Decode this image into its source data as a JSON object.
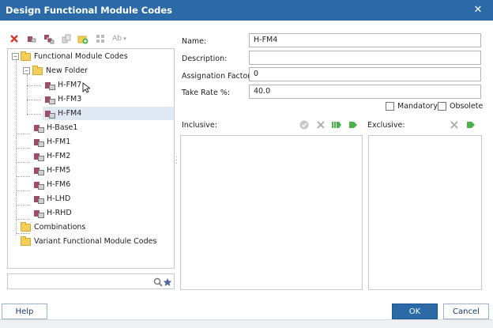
{
  "window": {
    "title": "Design Functional Module Codes",
    "close_icon": "close-icon"
  },
  "toolbar": {
    "icons": [
      "delete-icon",
      "functional-module-icon",
      "functional-module-group-icon",
      "copy-icon",
      "new-folder-icon",
      "grid-icon",
      "rename-icon",
      "dropdown-icon"
    ]
  },
  "tree": {
    "nodes": [
      {
        "label": "Functional Module Codes",
        "icon": "folder-open-icon"
      },
      {
        "label": "New Folder",
        "icon": "folder-open-icon"
      },
      {
        "label": "H-FM7",
        "icon": "functional-module-icon"
      },
      {
        "label": "H-FM3",
        "icon": "functional-module-icon"
      },
      {
        "label": "H-FM4",
        "icon": "functional-module-icon",
        "selected": true
      },
      {
        "label": "H-Base1",
        "icon": "functional-module-icon"
      },
      {
        "label": "H-FM1",
        "icon": "functional-module-icon"
      },
      {
        "label": "H-FM2",
        "icon": "functional-module-icon"
      },
      {
        "label": "H-FM5",
        "icon": "functional-module-icon"
      },
      {
        "label": "H-FM6",
        "icon": "functional-module-icon"
      },
      {
        "label": "H-LHD",
        "icon": "functional-module-icon"
      },
      {
        "label": "H-RHD",
        "icon": "functional-module-icon"
      },
      {
        "label": "Combinations",
        "icon": "folder-icon"
      },
      {
        "label": "Variant Functional Module Codes",
        "icon": "folder-icon"
      }
    ],
    "expanders": [
      "−",
      "−"
    ]
  },
  "search": {
    "value": "",
    "icons": [
      "search-icon",
      "star-icon"
    ]
  },
  "form": {
    "name_label": "Name:",
    "name_value": "H-FM4",
    "description_label": "Description:",
    "description_value": "",
    "assignation_label": "Assignation Factor:",
    "assignation_value": "0",
    "take_rate_label": "Take Rate %:",
    "take_rate_value": "40.0",
    "mandatory_label": "Mandatory",
    "obsolete_label": "Obsolete"
  },
  "inclusive": {
    "label": "Inclusive:",
    "icons": [
      "validate-icon",
      "remove-icon",
      "add-multiple-icon",
      "add-icon"
    ]
  },
  "exclusive": {
    "label": "Exclusive:",
    "icons": [
      "remove-icon",
      "add-icon"
    ]
  },
  "buttons": {
    "help": "Help",
    "ok": "OK",
    "cancel": "Cancel"
  },
  "colors": {
    "title_bar": "#2b6aa6",
    "selection": "#dfe8f3",
    "folder": "#f2cf5b",
    "module": "#9f4c6a",
    "green": "#4bb14b"
  }
}
